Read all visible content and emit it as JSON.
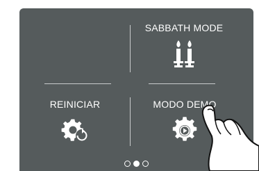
{
  "tiles": {
    "sabbath_mode": {
      "label": "SABBATH MODE",
      "icon": "candles-icon"
    },
    "reiniciar": {
      "label": "REINICIAR",
      "icon": "gear-restart-icon"
    },
    "modo_demo": {
      "label": "MODO DEMO",
      "icon": "gear-play-icon"
    }
  },
  "pager": {
    "pages": 3,
    "active_index": 1
  },
  "colors": {
    "screen_bg": "#555b5c",
    "divider": "#c8cbcc",
    "text": "#ffffff"
  }
}
